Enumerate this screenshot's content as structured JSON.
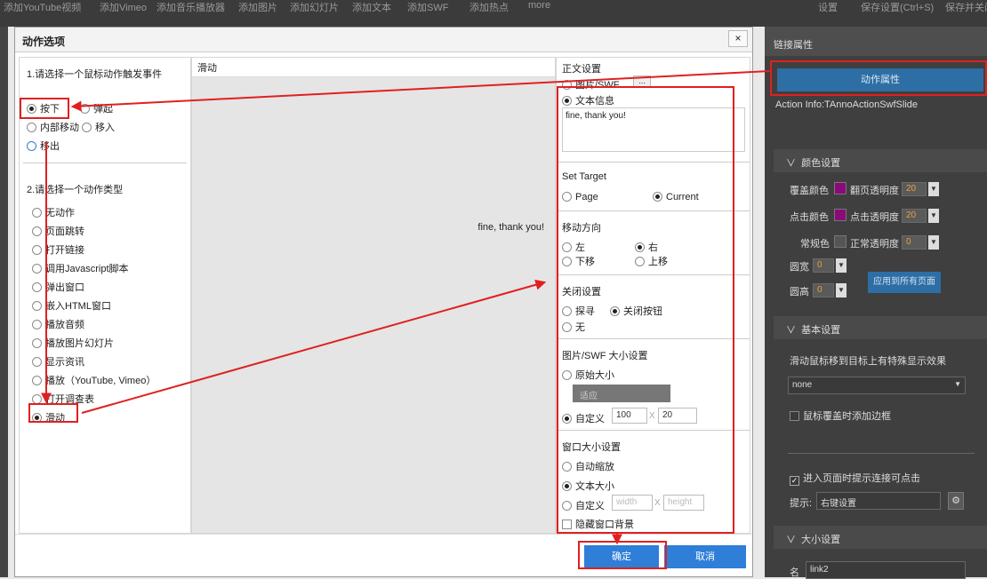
{
  "toolbar": {
    "items": [
      "添加YouTube视频",
      "添加Vimeo",
      "添加音乐播放器",
      "添加图片",
      "添加幻灯片",
      "添加文本",
      "添加SWF",
      "添加热点",
      "more"
    ],
    "settings": "设置",
    "save": "保存设置(Ctrl+S)",
    "save_close": "保存并关闭"
  },
  "right_panel": {
    "title": "链接属性",
    "action_button": "动作属性",
    "action_info": "Action Info:TAnnoActionSwfSlide",
    "color_section": {
      "title": "颜色设置",
      "overlay_color_label": "覆盖颜色",
      "flip_opacity_label": "翻页透明度",
      "flip_opacity_value": "20",
      "click_color_label": "点击颜色",
      "click_opacity_label": "点击透明度",
      "click_opacity_value": "20",
      "normal_color_label": "常规色",
      "normal_opacity_label": "正常透明度",
      "normal_opacity_value": "0",
      "corner_w_label": "圆宽",
      "corner_w_value": "0",
      "corner_h_label": "圆高",
      "corner_h_value": "0",
      "apply_all": "应用到所有页面",
      "overlay_color": "#8b0a7a",
      "click_color": "#8b0a7a",
      "normal_color": "#555555"
    },
    "basic_section": {
      "title": "基本设置",
      "hover_label": "滑动鼠标移到目标上有特殊显示效果",
      "hover_value": "none",
      "border_label": "鼠标覆盖时添加边框",
      "prompt_check_label": "进入页面时提示连接可点击",
      "hint_label": "提示:",
      "hint_value": "右键设置"
    },
    "size_section": {
      "title": "大小设置",
      "name_label": "名",
      "name_value": "link2"
    }
  },
  "dialog": {
    "title": "动作选项",
    "close": "×",
    "step1_title": "1.请选择一个鼠标动作触发事件",
    "events": {
      "press": "按下",
      "release": "弹起",
      "move_inside": "内部移动",
      "move_in": "移入",
      "move_out": "移出"
    },
    "step2_title": "2.请选择一个动作类型",
    "action_types": [
      "无动作",
      "页面跳转",
      "打开链接",
      "调用Javascript脚本",
      "弹出窗口",
      "嵌入HTML窗口",
      "播放音频",
      "播放图片幻灯片",
      "显示资讯",
      "播放（YouTube, Vimeo）",
      "打开调查表",
      "滑动"
    ],
    "preview_title": "滑动",
    "preview_text": "fine, thank you!",
    "content": {
      "title": "正文设置",
      "image_swf": "图片/SWF",
      "browse": "...",
      "text_info": "文本信息",
      "text_value": "fine, thank you!"
    },
    "target": {
      "title": "Set Target",
      "page": "Page",
      "current": "Current"
    },
    "direction": {
      "title": "移动方向",
      "left": "左",
      "right": "右",
      "down": "下移",
      "up": "上移"
    },
    "close_setting": {
      "title": "关闭设置",
      "explore": "探寻",
      "close_button": "关闭按钮",
      "none": "无"
    },
    "img_size": {
      "title": "图片/SWF 大小设置",
      "original": "原始大小",
      "fit": "适应",
      "custom": "自定义",
      "width": "100",
      "height": "20",
      "x": "X"
    },
    "win_size": {
      "title": "窗口大小设置",
      "auto": "自动缩放",
      "text_size": "文本大小",
      "custom": "自定义",
      "width_ph": "width",
      "height_ph": "height",
      "x": "X",
      "hide_bg": "隐藏窗口背景"
    },
    "ok": "确定",
    "cancel": "取消"
  }
}
